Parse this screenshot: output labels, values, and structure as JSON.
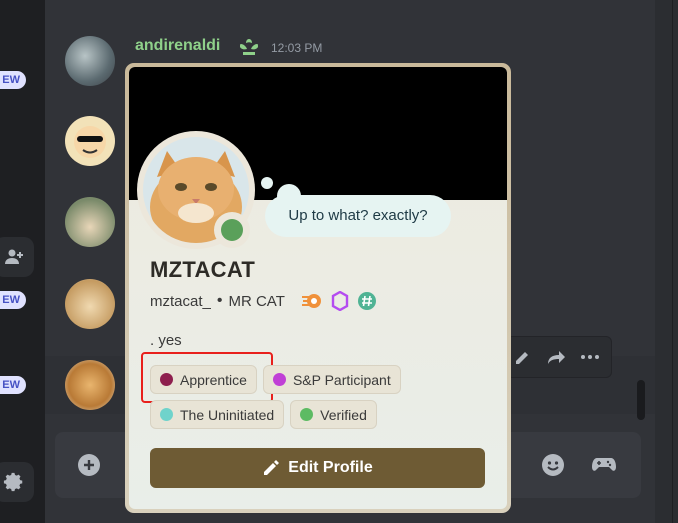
{
  "server_strip": {
    "new_badges": [
      "EW",
      "EW",
      "EW"
    ]
  },
  "chat": {
    "message": {
      "author": "andirenaldi",
      "timestamp": "12:03 PM"
    }
  },
  "profile": {
    "custom_status": "Up to what? exactly?",
    "display_name": "MZTACAT",
    "username": "mztacat_",
    "pronouns_or_tag": "MR CAT",
    "bio": ". yes",
    "roles": [
      {
        "name": "Apprentice",
        "color": "#8e1f4e"
      },
      {
        "name": "S&P Participant",
        "color": "#c03fd6"
      },
      {
        "name": "The Uninitiated",
        "color": "#6fd3cb"
      },
      {
        "name": "Verified",
        "color": "#5dbb63"
      }
    ],
    "edit_button": "Edit Profile"
  },
  "colors": {
    "author_name": "#8fd18a",
    "accent_button": "#6e5b34",
    "highlight": "#e8201c"
  }
}
